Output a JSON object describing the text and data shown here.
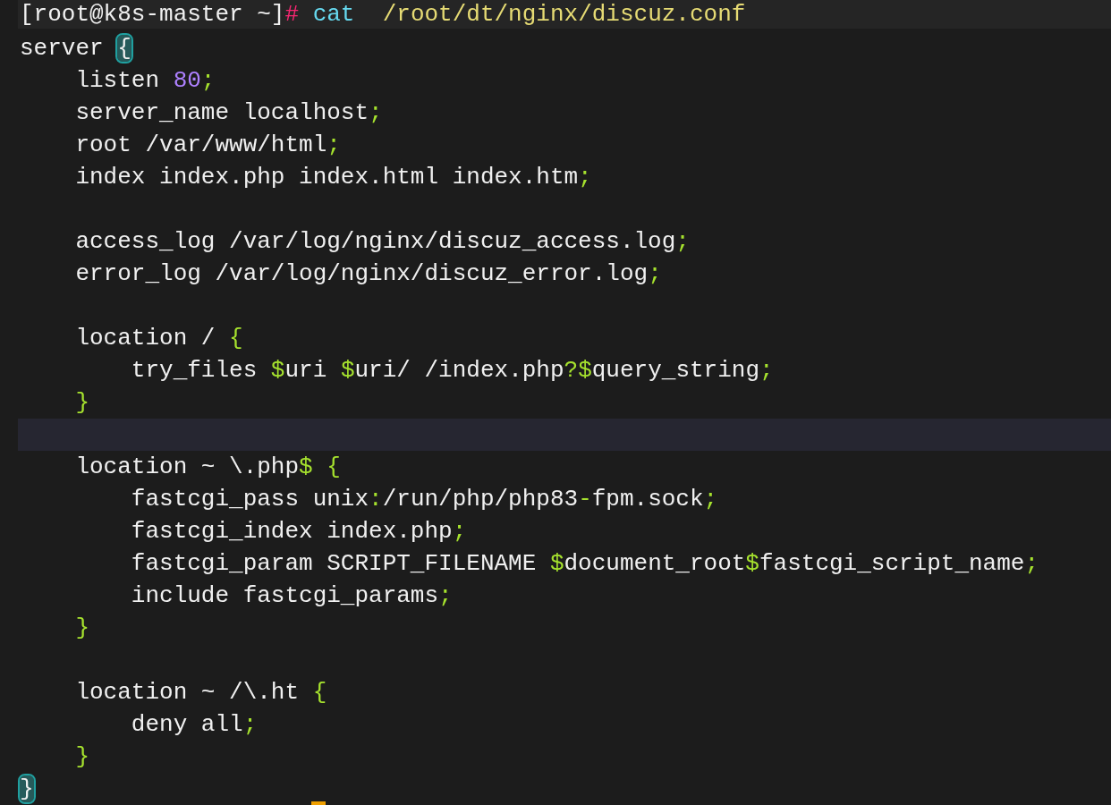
{
  "terminal": {
    "lines": [
      {
        "kind": "prompt",
        "current": false,
        "segments": [
          {
            "kind": "text",
            "text": "[root@k8s-master ~]"
          },
          {
            "kind": "hash",
            "text": "#"
          },
          {
            "kind": "command",
            "text": " cat"
          },
          {
            "kind": "path",
            "text": "  /root/dt/nginx/discuz.conf"
          }
        ]
      },
      {
        "kind": "code",
        "current": false,
        "segments": [
          {
            "kind": "text",
            "text": "server "
          },
          {
            "kind": "match",
            "text": "{"
          }
        ]
      },
      {
        "kind": "code",
        "current": false,
        "segments": [
          {
            "kind": "text",
            "text": "    listen "
          },
          {
            "kind": "number",
            "text": "80"
          },
          {
            "kind": "punct",
            "text": ";"
          }
        ]
      },
      {
        "kind": "code",
        "current": false,
        "segments": [
          {
            "kind": "text",
            "text": "    server_name localhost"
          },
          {
            "kind": "punct",
            "text": ";"
          }
        ]
      },
      {
        "kind": "code",
        "current": false,
        "segments": [
          {
            "kind": "text",
            "text": "    root /var/www/html"
          },
          {
            "kind": "punct",
            "text": ";"
          }
        ]
      },
      {
        "kind": "code",
        "current": false,
        "segments": [
          {
            "kind": "text",
            "text": "    index index.php index.html index.htm"
          },
          {
            "kind": "punct",
            "text": ";"
          }
        ]
      },
      {
        "kind": "code"
      },
      {
        "kind": "code",
        "current": false,
        "segments": [
          {
            "kind": "text",
            "text": "    access_log /var/log/nginx/discuz_access.log"
          },
          {
            "kind": "punct",
            "text": ";"
          }
        ]
      },
      {
        "kind": "code",
        "current": false,
        "segments": [
          {
            "kind": "text",
            "text": "    error_log /var/log/nginx/discuz_error.log"
          },
          {
            "kind": "punct",
            "text": ";"
          }
        ]
      },
      {
        "kind": "code"
      },
      {
        "kind": "code",
        "current": false,
        "segments": [
          {
            "kind": "text",
            "text": "    location / "
          },
          {
            "kind": "punct",
            "text": "{"
          }
        ]
      },
      {
        "kind": "code",
        "current": false,
        "segments": [
          {
            "kind": "text",
            "text": "        try_files "
          },
          {
            "kind": "punct",
            "text": "$"
          },
          {
            "kind": "text",
            "text": "uri "
          },
          {
            "kind": "punct",
            "text": "$"
          },
          {
            "kind": "text",
            "text": "uri/ /index.php"
          },
          {
            "kind": "punct",
            "text": "?$"
          },
          {
            "kind": "text",
            "text": "query_string"
          },
          {
            "kind": "punct",
            "text": ";"
          }
        ]
      },
      {
        "kind": "code",
        "current": false,
        "segments": [
          {
            "kind": "punct",
            "text": "    }"
          }
        ]
      },
      {
        "kind": "code",
        "current": true
      },
      {
        "kind": "code",
        "current": false,
        "segments": [
          {
            "kind": "text",
            "text": "    location ~ \\.php"
          },
          {
            "kind": "punct",
            "text": "$ {"
          }
        ]
      },
      {
        "kind": "code",
        "current": false,
        "segments": [
          {
            "kind": "text",
            "text": "        fastcgi_pass unix"
          },
          {
            "kind": "punct",
            "text": ":"
          },
          {
            "kind": "text",
            "text": "/run/php/php83"
          },
          {
            "kind": "punct",
            "text": "-"
          },
          {
            "kind": "text",
            "text": "fpm.sock"
          },
          {
            "kind": "punct",
            "text": ";"
          }
        ]
      },
      {
        "kind": "code",
        "current": false,
        "segments": [
          {
            "kind": "text",
            "text": "        fastcgi_index index.php"
          },
          {
            "kind": "punct",
            "text": ";"
          }
        ]
      },
      {
        "kind": "code",
        "current": false,
        "segments": [
          {
            "kind": "text",
            "text": "        fastcgi_param SCRIPT_FILENAME "
          },
          {
            "kind": "punct",
            "text": "$"
          },
          {
            "kind": "text",
            "text": "document_root"
          },
          {
            "kind": "punct",
            "text": "$"
          },
          {
            "kind": "text",
            "text": "fastcgi_script_name"
          },
          {
            "kind": "punct",
            "text": ";"
          }
        ]
      },
      {
        "kind": "code",
        "current": false,
        "segments": [
          {
            "kind": "text",
            "text": "        include fastcgi_params"
          },
          {
            "kind": "punct",
            "text": ";"
          }
        ]
      },
      {
        "kind": "code",
        "current": false,
        "segments": [
          {
            "kind": "punct",
            "text": "    }"
          }
        ]
      },
      {
        "kind": "code"
      },
      {
        "kind": "code",
        "current": false,
        "segments": [
          {
            "kind": "text",
            "text": "    location ~ /\\.ht "
          },
          {
            "kind": "punct",
            "text": "{"
          }
        ]
      },
      {
        "kind": "code",
        "current": false,
        "segments": [
          {
            "kind": "text",
            "text": "        deny all"
          },
          {
            "kind": "punct",
            "text": ";"
          }
        ]
      },
      {
        "kind": "code",
        "current": false,
        "segments": [
          {
            "kind": "punct",
            "text": "    }"
          }
        ]
      },
      {
        "kind": "code",
        "current": false,
        "segments": [
          {
            "kind": "match",
            "text": "}"
          }
        ]
      }
    ]
  }
}
